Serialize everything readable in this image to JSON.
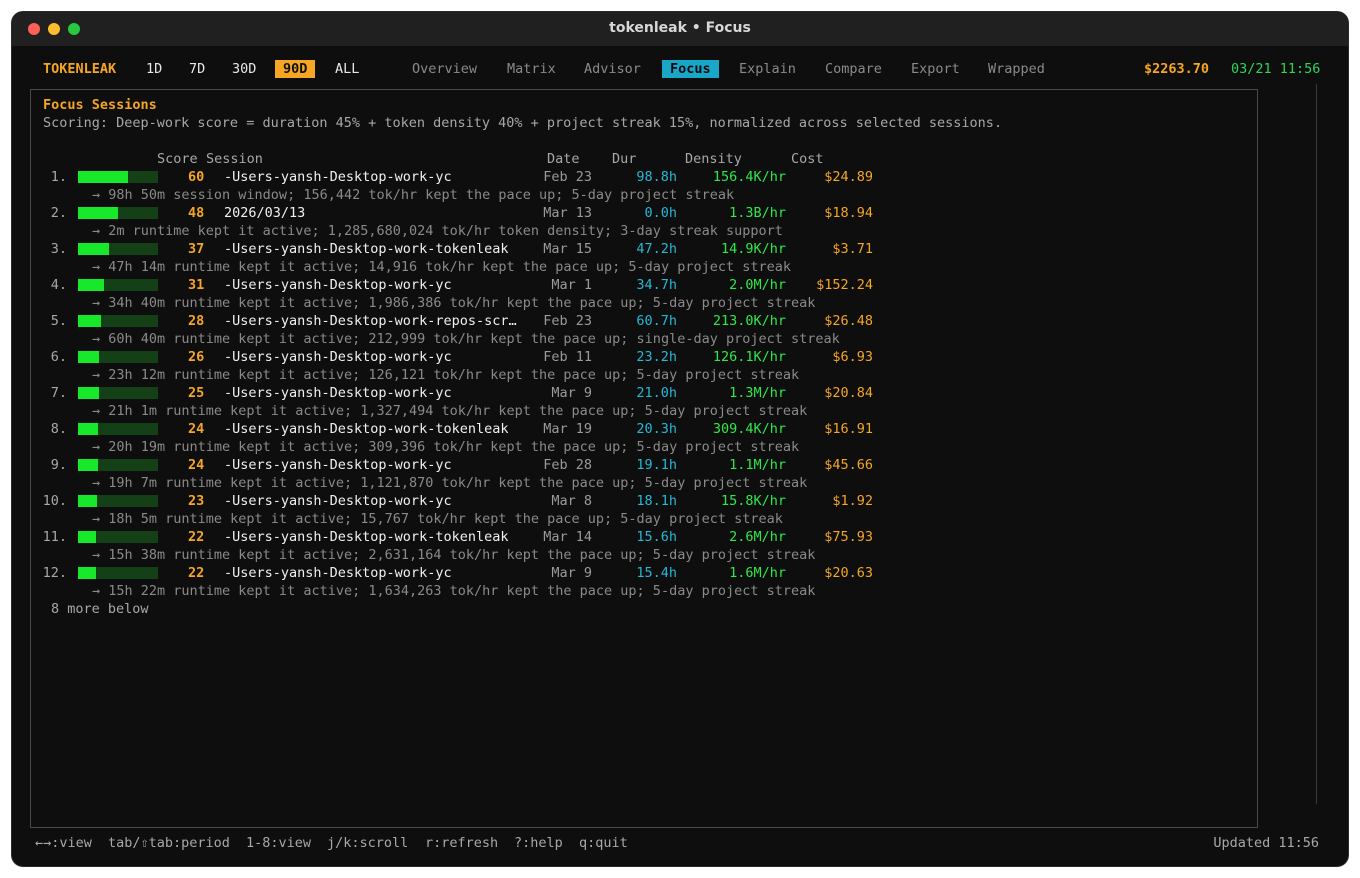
{
  "window": {
    "title": "tokenleak • Focus"
  },
  "topbar": {
    "brand": "TOKENLEAK",
    "periods": [
      "1D",
      "7D",
      "30D",
      "90D",
      "ALL"
    ],
    "active_period": "90D",
    "tabs": [
      "Overview",
      "Matrix",
      "Advisor",
      "Focus",
      "Explain",
      "Compare",
      "Export",
      "Wrapped"
    ],
    "active_tab": "Focus",
    "total": "$2263.70",
    "clock": "03/21 11:56"
  },
  "panel": {
    "title": "Focus Sessions",
    "scoring": "Scoring: Deep-work score = duration 45% + token density 40% + project streak 15%, normalized across selected sessions.",
    "headers": {
      "score": "Score",
      "session": "Session",
      "date": "Date",
      "dur": "Dur",
      "density": "Density",
      "cost": "Cost"
    },
    "rows": [
      {
        "idx": "1.",
        "score": "60",
        "score_fill": 0.6,
        "session": "-Users-yansh-Desktop-work-yc",
        "date": "Feb 23",
        "dur": "98.8h",
        "density": "156.4K/hr",
        "cost": "$24.89",
        "hint": "→ 98h 50m session window; 156,442 tok/hr kept the pace up; 5-day project streak"
      },
      {
        "idx": "2.",
        "score": "48",
        "score_fill": 0.48,
        "session": "2026/03/13",
        "date": "Mar 13",
        "dur": "0.0h",
        "density": "1.3B/hr",
        "cost": "$18.94",
        "hint": "→ 2m runtime kept it active; 1,285,680,024 tok/hr token density; 3-day streak support"
      },
      {
        "idx": "3.",
        "score": "37",
        "score_fill": 0.37,
        "session": "-Users-yansh-Desktop-work-tokenleak",
        "date": "Mar 15",
        "dur": "47.2h",
        "density": "14.9K/hr",
        "cost": "$3.71",
        "hint": "→ 47h 14m runtime kept it active; 14,916 tok/hr kept the pace up; 5-day project streak"
      },
      {
        "idx": "4.",
        "score": "31",
        "score_fill": 0.31,
        "session": "-Users-yansh-Desktop-work-yc",
        "date": "Mar 1",
        "dur": "34.7h",
        "density": "2.0M/hr",
        "cost": "$152.24",
        "hint": "→ 34h 40m runtime kept it active; 1,986,386 tok/hr kept the pace up; 5-day project streak"
      },
      {
        "idx": "5.",
        "score": "28",
        "score_fill": 0.28,
        "session": "-Users-yansh-Desktop-work-repos-scr…",
        "date": "Feb 23",
        "dur": "60.7h",
        "density": "213.0K/hr",
        "cost": "$26.48",
        "hint": "→ 60h 40m runtime kept it active; 212,999 tok/hr kept the pace up; single-day project streak"
      },
      {
        "idx": "6.",
        "score": "26",
        "score_fill": 0.26,
        "session": "-Users-yansh-Desktop-work-yc",
        "date": "Feb 11",
        "dur": "23.2h",
        "density": "126.1K/hr",
        "cost": "$6.93",
        "hint": "→ 23h 12m runtime kept it active; 126,121 tok/hr kept the pace up; 5-day project streak"
      },
      {
        "idx": "7.",
        "score": "25",
        "score_fill": 0.25,
        "session": "-Users-yansh-Desktop-work-yc",
        "date": "Mar 9",
        "dur": "21.0h",
        "density": "1.3M/hr",
        "cost": "$20.84",
        "hint": "→ 21h 1m runtime kept it active; 1,327,494 tok/hr kept the pace up; 5-day project streak"
      },
      {
        "idx": "8.",
        "score": "24",
        "score_fill": 0.24,
        "session": "-Users-yansh-Desktop-work-tokenleak",
        "date": "Mar 19",
        "dur": "20.3h",
        "density": "309.4K/hr",
        "cost": "$16.91",
        "hint": "→ 20h 19m runtime kept it active; 309,396 tok/hr kept the pace up; 5-day project streak"
      },
      {
        "idx": "9.",
        "score": "24",
        "score_fill": 0.24,
        "session": "-Users-yansh-Desktop-work-yc",
        "date": "Feb 28",
        "dur": "19.1h",
        "density": "1.1M/hr",
        "cost": "$45.66",
        "hint": "→ 19h 7m runtime kept it active; 1,121,870 tok/hr kept the pace up; 5-day project streak"
      },
      {
        "idx": "10.",
        "score": "23",
        "score_fill": 0.23,
        "session": "-Users-yansh-Desktop-work-yc",
        "date": "Mar 8",
        "dur": "18.1h",
        "density": "15.8K/hr",
        "cost": "$1.92",
        "hint": "→ 18h 5m runtime kept it active; 15,767 tok/hr kept the pace up; 5-day project streak"
      },
      {
        "idx": "11.",
        "score": "22",
        "score_fill": 0.22,
        "session": "-Users-yansh-Desktop-work-tokenleak",
        "date": "Mar 14",
        "dur": "15.6h",
        "density": "2.6M/hr",
        "cost": "$75.93",
        "hint": "→ 15h 38m runtime kept it active; 2,631,164 tok/hr kept the pace up; 5-day project streak"
      },
      {
        "idx": "12.",
        "score": "22",
        "score_fill": 0.22,
        "session": "-Users-yansh-Desktop-work-yc",
        "date": "Mar 9",
        "dur": "15.4h",
        "density": "1.6M/hr",
        "cost": "$20.63",
        "hint": "→ 15h 22m runtime kept it active; 1,634,263 tok/hr kept the pace up; 5-day project streak"
      }
    ],
    "more": "8 more below"
  },
  "footer": {
    "keys": [
      "←→:view",
      "tab/⇧tab:period",
      "1-8:view",
      "j/k:scroll",
      "r:refresh",
      "?:help",
      "q:quit"
    ],
    "updated": "Updated 11:56"
  },
  "colors": {
    "accent": "#f5a623",
    "active_tab": "#19a7c9",
    "bar_fill": "#18e82a",
    "duration": "#25b8d8",
    "density": "#2ee84a",
    "clock": "#2fd35a"
  }
}
